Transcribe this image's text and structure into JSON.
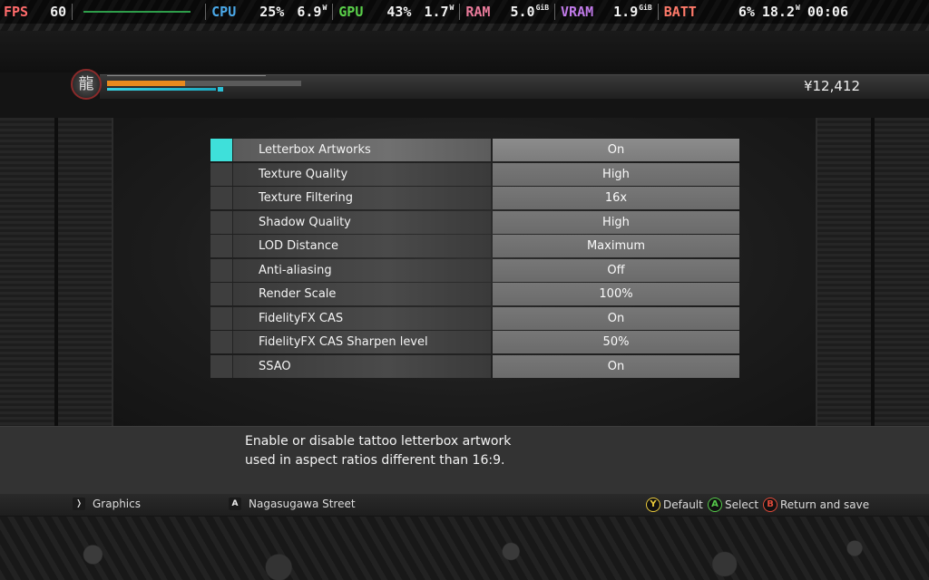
{
  "overlay": {
    "fps": {
      "label": "FPS",
      "value": "60",
      "color": "#ff6b6b"
    },
    "cpu": {
      "label": "CPU",
      "usage": "25%",
      "power": "6.9",
      "unit": "W",
      "color": "#4aa8e8"
    },
    "gpu": {
      "label": "GPU",
      "usage": "43%",
      "power": "1.7",
      "unit": "W",
      "color": "#5ad04a"
    },
    "ram": {
      "label": "RAM",
      "value": "5.0",
      "unit": "GiB",
      "color": "#e87a9a"
    },
    "vram": {
      "label": "VRAM",
      "value": "1.9",
      "unit": "GiB",
      "color": "#c07ae8"
    },
    "batt": {
      "label": "BATT",
      "percent": "6%",
      "power": "18.2",
      "unit": "W",
      "color": "#ff7a6a"
    },
    "clock": "00:06"
  },
  "hud": {
    "emblem_glyph": "龍",
    "money": "¥12,412",
    "health_fraction": 0.4
  },
  "settings": {
    "selected_index": 0,
    "accent_color": "#3ee0da",
    "rows": [
      {
        "name": "Letterbox Artworks",
        "value": "On"
      },
      {
        "name": "Texture Quality",
        "value": "High"
      },
      {
        "name": "Texture Filtering",
        "value": "16x"
      },
      {
        "name": "Shadow Quality",
        "value": "High"
      },
      {
        "name": "LOD Distance",
        "value": "Maximum"
      },
      {
        "name": "Anti-aliasing",
        "value": "Off"
      },
      {
        "name": "Render Scale",
        "value": "100%"
      },
      {
        "name": "FidelityFX CAS",
        "value": "On"
      },
      {
        "name": "FidelityFX CAS Sharpen level",
        "value": "50%"
      },
      {
        "name": "SSAO",
        "value": "On"
      }
    ]
  },
  "description": {
    "line1": "Enable or disable tattoo letterbox artwork",
    "line2": "used in aspect ratios different than 16:9."
  },
  "footer": {
    "left_key": "❭",
    "left_label": "Graphics",
    "mid_key": "A",
    "mid_label": "Nagasugawa Street",
    "y_button": "Y",
    "y_label": "Default",
    "a_button": "A",
    "a_label": "Select",
    "b_button": "B",
    "b_label": "Return and save"
  }
}
